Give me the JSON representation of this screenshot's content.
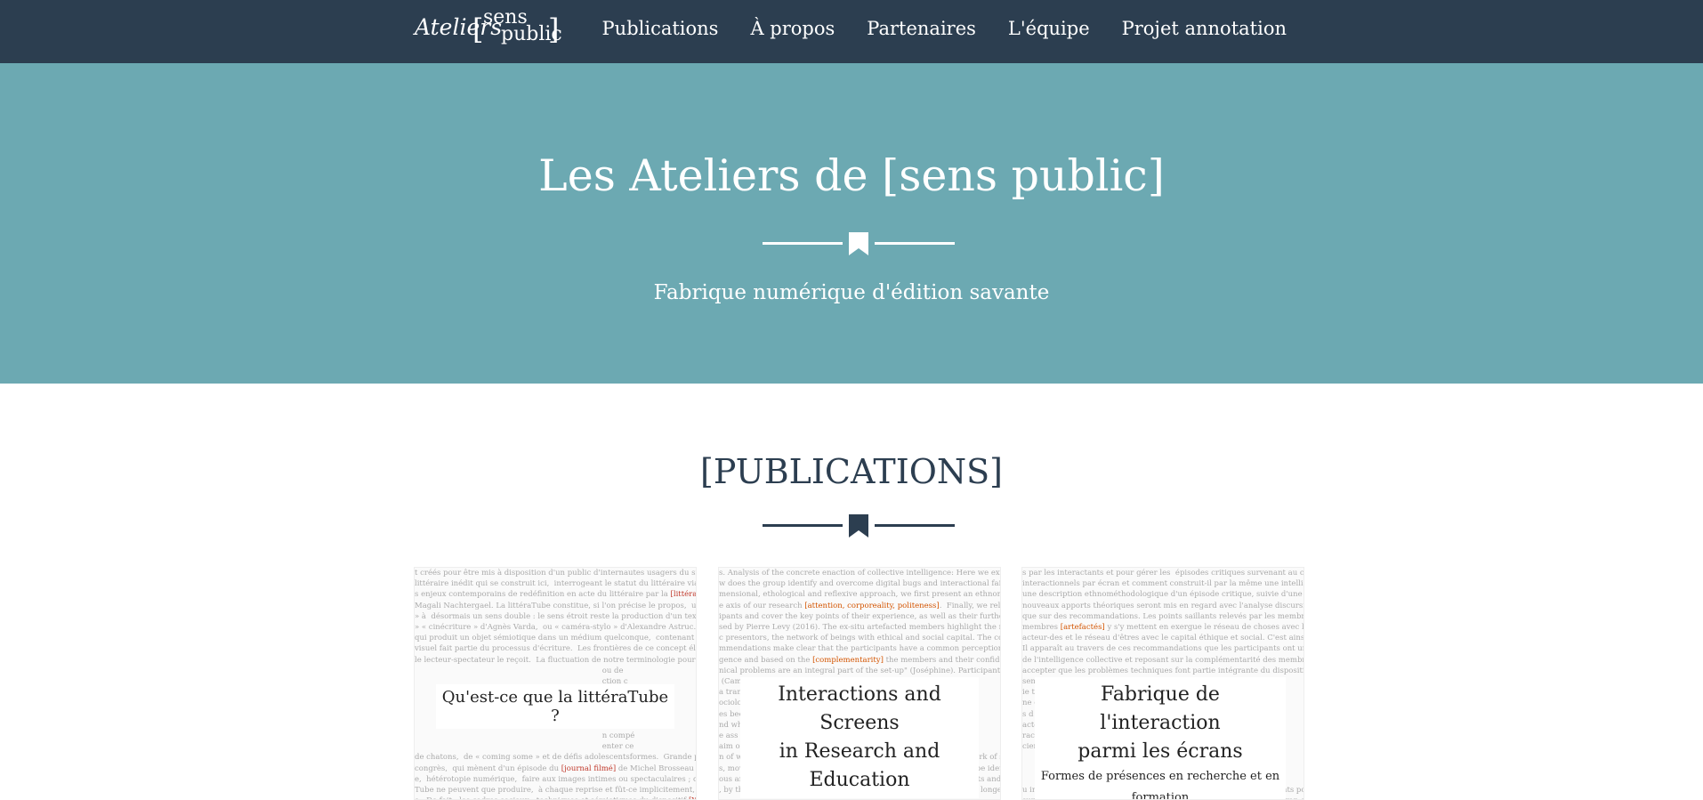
{
  "nav": {
    "logo": {
      "italic": "Ateliers",
      "open_bracket": "[",
      "line1": "sens",
      "line2": "public",
      "close_bracket": "]"
    },
    "links": [
      "Publications",
      "À propos",
      "Partenaires",
      "L'équipe",
      "Projet annotation"
    ]
  },
  "hero": {
    "title": "Les Ateliers de [sens public]",
    "subtitle": "Fabrique numérique d'édition savante"
  },
  "publications": {
    "heading": "[PUBLICATIONS]",
    "cards": [
      {
        "title": "Qu'est-ce que la littéraTube ?",
        "bg_lines": [
          "t créés pour être mis à disposition d'un public d'internautes usagers du site,  ou de contenus",
          "littéraire inédit qui se construit ici,  interrogeant le statut du littéraire via la mise en place de m",
          "s enjeux contemporains de redéfinition en acte du littéraire par la [littérature] numérique.  Se",
          "Magali Nachtergael. La littéraTube constitue, si l'on précise le propos,  un pan important de",
          "» à  désormais un sens double : le sens étroit reste la production d'un texte écrit avec les",
          "» « cinécriture » d'Agnès Varda,  ou « caméra-stylo » d'Alexandre Astruc.  C'est dans ce se",
          "qui produit un objet sémiotique dans un médium quelconque,  contenant ou non des élémen",
          "visuel fait partie du processus d'écriture.  Les frontières de ce concept élargi d'écriture restent",
          "le lecteur-spectateur le reçoit.  La fluctuation de notre terminologie pour désigner les artiste",
          "                                                                              ou de",
          "                                                                              ction c",
          "                                                                              s anné",
          "                                                                              les diff",
          "                                                                              stables d",
          "                                                                              élation c",
          "                                                                              n compé",
          "                                                                              enter ce",
          "de chatons,  de « coming some » et de défis adolescentsformes.  Grande partage des temp",
          "congrès,  qui mènent d'un épisode du [journal filmé] de Michel Brosseau aux dix plus beaux",
          "e,  hétérotopie numérique,  faire aux images intimes ou spectaculaires ; qu'ailleurs,  ces aut",
          "Tube ne peuvent que produire,  à chaque reprise et fût-ce implicitement,  un métadiscours jus",
          "e.  De fait,  les cadres sociaux,  techniques et sémiotiques du dispositif [YouTube] ont davantage"
        ]
      },
      {
        "title_line1": "Interactions and Screens",
        "title_line2": "in Research and Education",
        "bg_lines": [
          "s. Analysis of the concrete enaction of collective intelligence: Here we examine the ethnometh",
          "w does the group identify and overcome digital bugs and interactional failures in digital interac",
          "mensional, ethological and reflexive approach, we first present an ethnomethodological descrip",
          "e axis of our research [attention, corporeality, politeness].  Finally, we relate these new theoretic",
          "ipants and cover the key points of their experience, as well as their further recommendations. T",
          "sed by Pierre Levy (2016). The ex-situ artefacted members highlight the network of things with",
          "c presentors, the network of beings with ethical and social capital. The complementarity of the",
          "mmendations make clear that the participants have a common perception of the socio-technical",
          "gence and based on the [complementarity] the members and their confidence in their ability t",
          "nical problems are an integral part of the set-up\" (Joséphine). Participants thus simply need \"to",
          " (Cam                                                                         eraction o",
          "a trans                                                                       sing with c",
          "ociology                                                                      se technol",
          "es beca                                                                       ociated wi",
          "nd wha                                                                        to the co-",
          "e ass                                                                         e sense of",
          "aim of                                                                        ngs and o",
          "n of what we call technobodily ethnomethods. The aim in the network of signs is to create on",
          "s, movement and address). In the network of beings, roles need to be identified and multimod",
          "ous and thoughtful selection and integration of high-quality artefacts and on a technical support",
          ", by the group's members, interactional failures and digital bugs no longer prevent the mainten"
        ]
      },
      {
        "title_line1": "Fabrique de l'interaction",
        "title_line2": "parmi les écrans",
        "subtitle": "Formes de présences en recherche et en formation",
        "bg_lines": [
          "s par les interactants et pour gérer les  épisodes critiques survenant au cours de l'expérience écra",
          "interactionnels par écran et comment construit-il par la même une intelligence collective ? Prob",
          "une description ethnométhodologique d'un épisode critique, suivie d'une synthèse transdiscipl",
          "nouveaux apports théoriques seront mis en regard avec l'analyse discursive des questionnaires",
          "que sur des recommandations. Les points saillants relevés par les membres de cette expérien",
          "membres [artefactés] y s'y mettent en exergue le réseau de choses avec leur focus sur les écrans",
          "acteur-des et le réseau d'êtres avec le capital éthique et social. C'est ainsi que la complémentarité",
          "Il apparaît au travers de ces recommandations que les participants ont une perception comm",
          "de l'intelligence collective et reposant sur la complémentarité des membres et leur confiance dan",
          "accepter que les problèmes techniques font partie intégrante du dispositif » (Joséphine). Il con",
          "sener                                                                         ans arrête o",
          "ie tr                                                                         'échange l",
          "ne c                                                                          alyse discu",
          "s d                                                                           oche les m",
          "acte                                                                          renf conce",
          "rac                                                                           utilité cou",
          "cien                                                                          bats » la r",
          "                                                                              n 2 fois on",
          "                                                                              1, 6) s'y p",
          "                                                                              ses associé",
          "u interrogeons ici  sur les ethnométhodes utilisées par les interactants pour gérer les  épisode",
          "surmonte-t-il les bugs numériques et les ratés interactionnels par écran et comment construit-il"
        ]
      }
    ]
  },
  "colors": {
    "nav_bg": "#2c3e50",
    "hero_bg": "#6ca9b2",
    "heading": "#2c3e50",
    "highlight": "#c0392b"
  },
  "icons": [
    "bookmark-icon"
  ]
}
